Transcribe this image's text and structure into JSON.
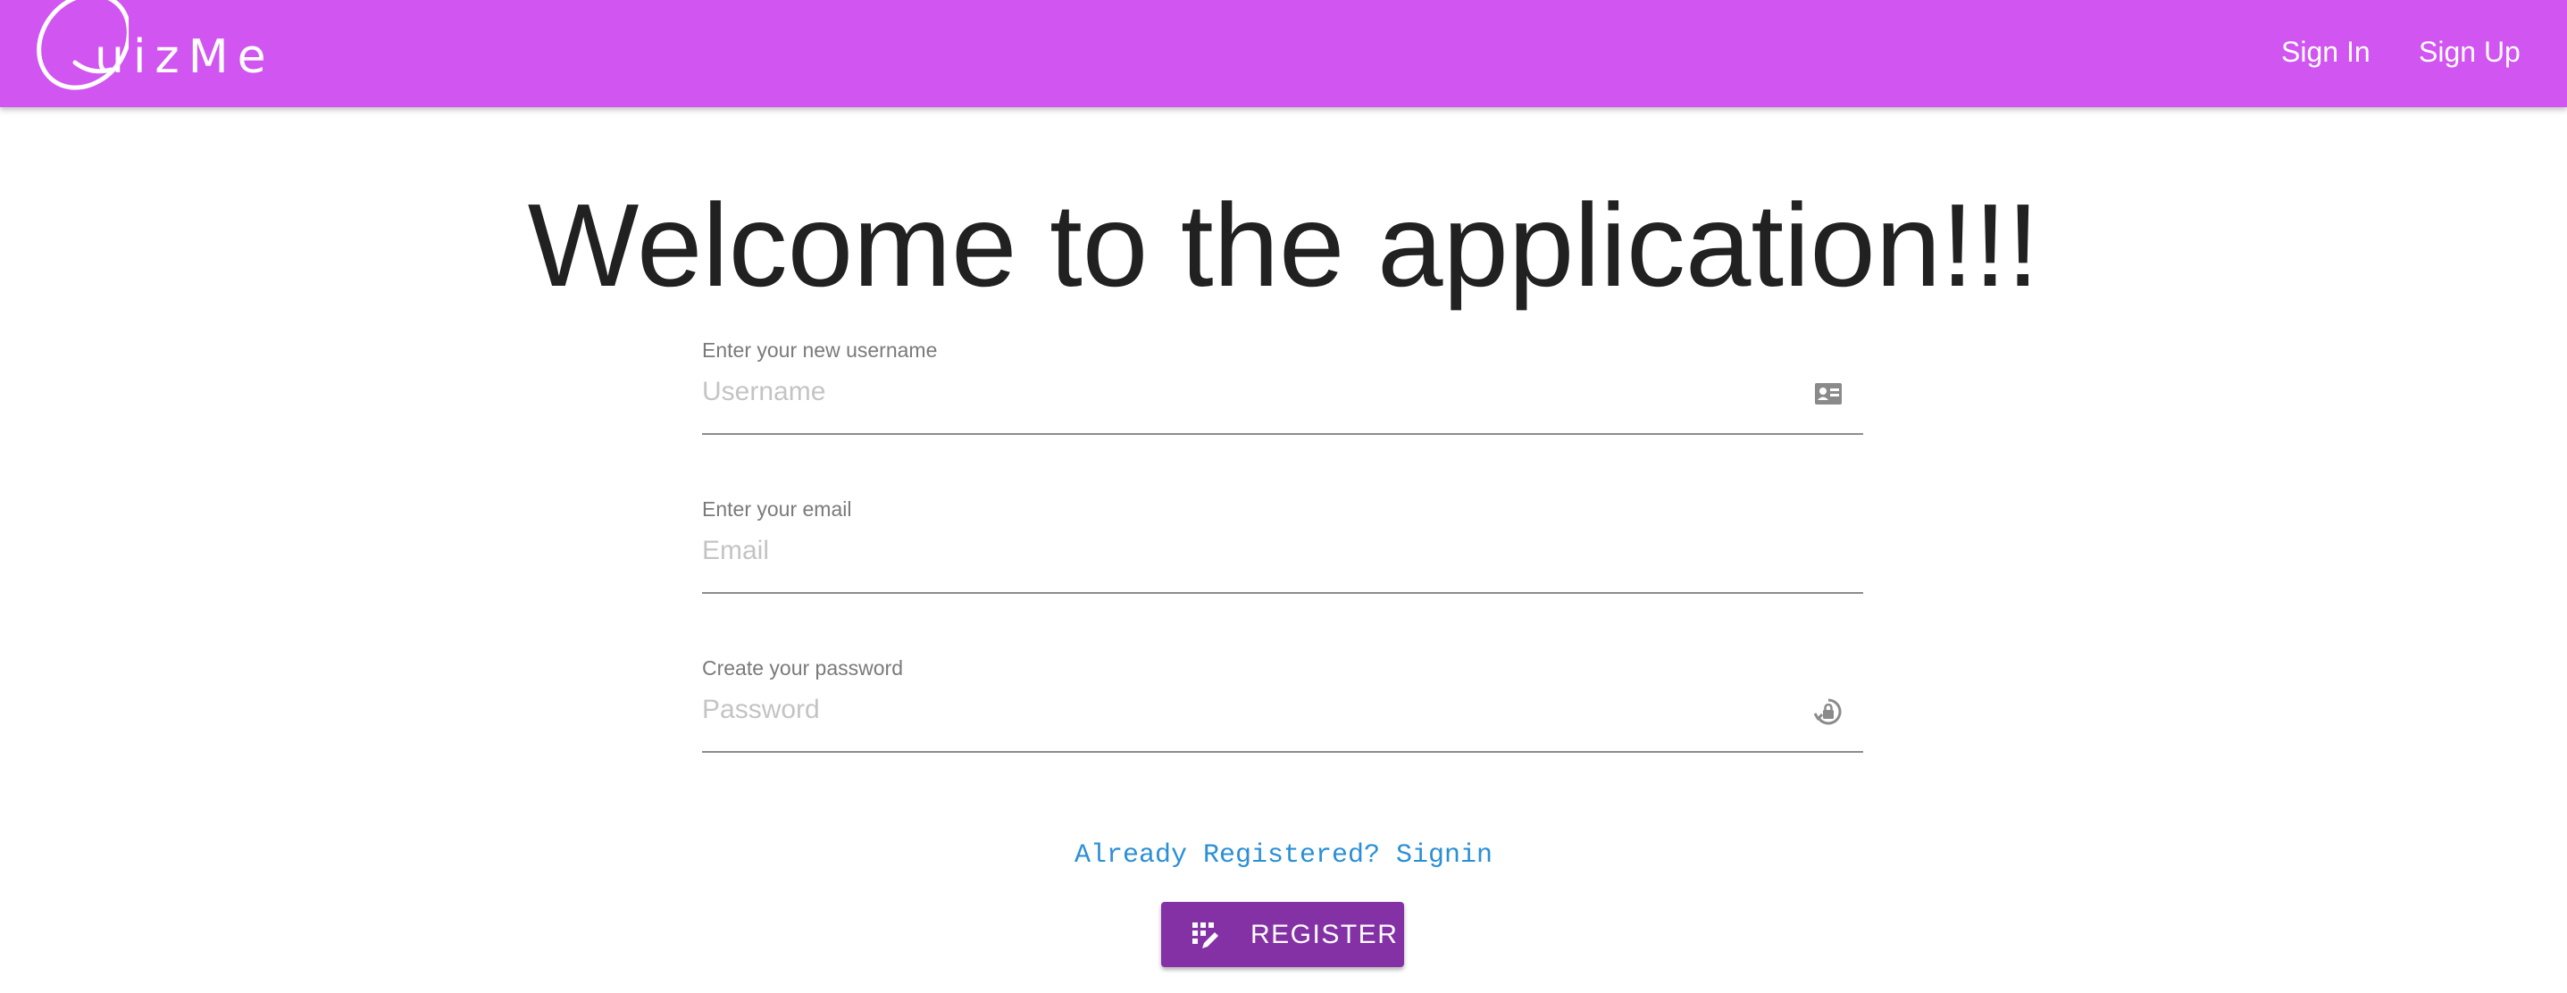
{
  "header": {
    "logo_text": "uizMe",
    "nav": {
      "signin_label": "Sign In",
      "signup_label": "Sign Up"
    },
    "bg_color": "#d155f1"
  },
  "main": {
    "heading": "Welcome to the application!!!",
    "form": {
      "username": {
        "label": "Enter your new username",
        "placeholder": "Username",
        "value": "",
        "icon": "id-card-icon"
      },
      "email": {
        "label": "Enter your email",
        "placeholder": "Email",
        "value": ""
      },
      "password": {
        "label": "Create your password",
        "placeholder": "Password",
        "value": "",
        "icon": "lock-reset-icon"
      }
    },
    "signin_link": "Already Registered? Signin",
    "register_button": {
      "label": "REGISTER",
      "icon": "keypad-edit-icon",
      "color": "#8431a6"
    },
    "link_color": "#2b8fd6"
  }
}
